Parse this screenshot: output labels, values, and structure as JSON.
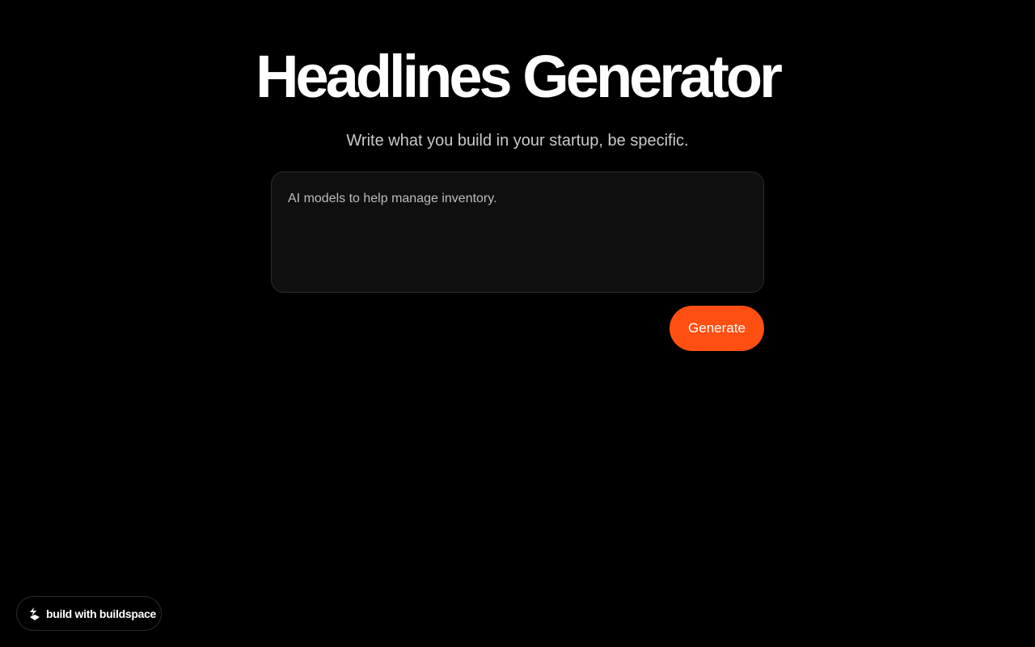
{
  "header": {
    "title": "Headlines Generator",
    "subtitle": "Write what you build in your startup, be specific."
  },
  "prompt": {
    "placeholder": "AI models to help manage inventory.",
    "value": ""
  },
  "actions": {
    "generate_label": "Generate"
  },
  "badge": {
    "label": "build with buildspace",
    "icon": "buildspace-logo-icon"
  },
  "colors": {
    "background": "#000000",
    "accent": "#ff4f12",
    "text": "#ffffff",
    "muted_text": "#c9c9c9",
    "input_background": "#0f0f0f"
  }
}
